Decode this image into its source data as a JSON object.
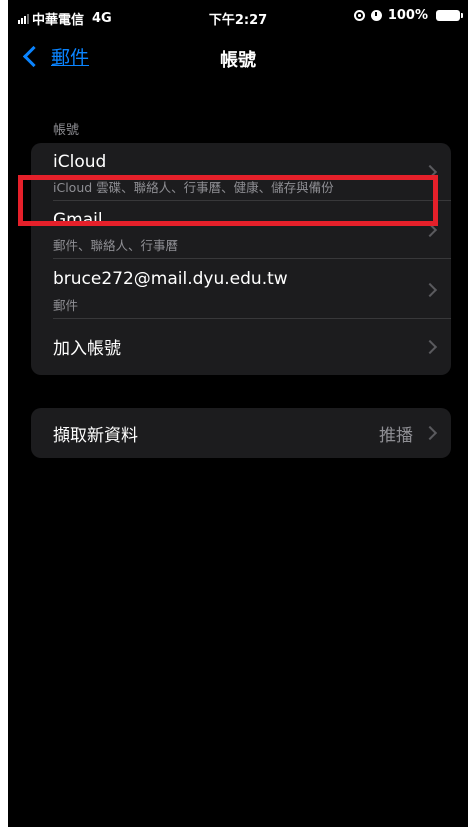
{
  "status_bar": {
    "carrier": "中華電信",
    "network": "4G",
    "time": "下午2:27",
    "battery": "100%",
    "icons": [
      "signal-icon",
      "rotation-lock-icon",
      "alarm-icon",
      "battery-icon"
    ]
  },
  "nav": {
    "back_label": "郵件",
    "title": "帳號"
  },
  "accounts": {
    "header": "帳號",
    "items": [
      {
        "title": "iCloud",
        "subtitle": "iCloud 雲碟、聯絡人、行事曆、健康、儲存與備份"
      },
      {
        "title": "Gmail",
        "subtitle": "郵件、聯絡人、行事曆"
      },
      {
        "title": "bruce272@mail.dyu.edu.tw",
        "subtitle": "郵件"
      },
      {
        "title": "加入帳號"
      }
    ]
  },
  "fetch": {
    "label": "擷取新資料",
    "value": "推播"
  },
  "colors": {
    "accent": "#0a84ff",
    "background": "#000000",
    "cell": "#1c1c1e",
    "highlight": "#e5202a"
  }
}
